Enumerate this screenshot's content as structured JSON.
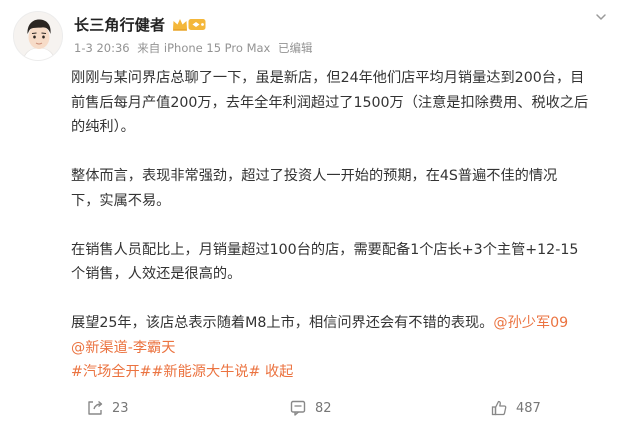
{
  "author": {
    "name": "长三角行健者",
    "badge_icon": "crown-badge-icon",
    "badge_color": "#f4b73a"
  },
  "meta": {
    "time": "1-3 20:36",
    "source": "来自 iPhone 15 Pro Max",
    "edited": "已编辑"
  },
  "content": {
    "p1_lines": [
      "刚刚与某问界店总聊了一下，虽是新店，但24年他们店平均月销量达到200台，目",
      "前售后每月产值200万，去年全年利润超过了1500万（注意是扣除费用、税收之后",
      "的纯利）。"
    ],
    "p2_lines": [
      "整体而言，表现非常强劲，超过了投资人一开始的预期，在4S普遍不佳的情况",
      "下，实属不易。"
    ],
    "p3_lines": [
      "在销售人员配比上，月销量超过100台的店，需要配备1个店长+3个主管+12-15",
      "个销售，人效还是很高的。"
    ],
    "p4_text": "展望25年，该店总表示随着M8上市，相信问界还会有不错的表现。",
    "mention1": "@孙少军09",
    "mention2": "@新渠道-李霸天",
    "topic1": "#汽场全开#",
    "topic2": "#新能源大牛说#",
    "collapse": "收起"
  },
  "actions": {
    "share_count": "23",
    "comment_count": "82",
    "like_count": "487"
  },
  "colors": {
    "link": "#eb7340",
    "meta": "#939393",
    "text": "#333333"
  }
}
